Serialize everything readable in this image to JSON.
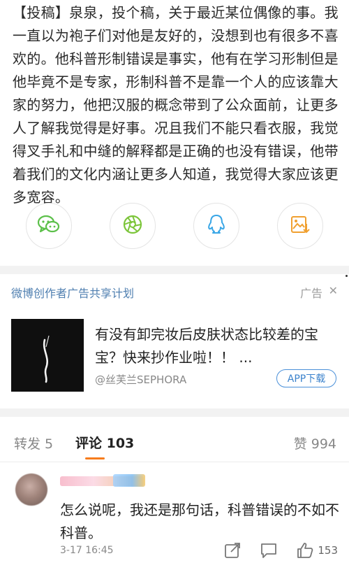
{
  "post": {
    "text": "【投稿】泉泉，投个稿，关于最近某位偶像的事。我一直以为袍子们对他是友好的，没想到也有很多不喜欢的。他科普形制错误是事实，他有在学习形制但是他毕竟不是专家，形制科普不是靠一个人的应该靠大家的努力，他把汉服的概念带到了公众面前，让更多人了解我觉得是好事。况且我们不能只看衣服，我觉得叉手礼和中缝的解释都是正确的也没有错误，他带着我们的文化内涵让更多人知道，我觉得大家应该更多宽容。"
  },
  "share": {
    "icons": [
      "wechat-icon",
      "moments-icon",
      "qq-icon",
      "save-image-icon"
    ],
    "colors": {
      "wechat": "#5cc04a",
      "moments": "#7cc53a",
      "qq": "#39a6e6",
      "save": "#f0a030"
    }
  },
  "ad": {
    "plan_label": "微博创作者广告共享计划",
    "ad_label": "广告",
    "close_icon": "close-icon",
    "title": "有没有卸完妆后皮肤状态比较差的宝宝？快来抄作业啦！！ ...",
    "brand": "@丝芙兰SEPHORA",
    "download_label": "APP下载",
    "accent": "#3b82cc"
  },
  "tabs": {
    "repost": "转发 5",
    "comments": "评论 103",
    "likes": "赞 994",
    "accent": "#f77c1c"
  },
  "comment": {
    "text": "怎么说呢，我还是那句话，科普错误的不如不科普。",
    "time": "3-17 16:45",
    "like_count": "153",
    "actions": [
      "share-icon",
      "comment-icon",
      "like-icon"
    ]
  }
}
